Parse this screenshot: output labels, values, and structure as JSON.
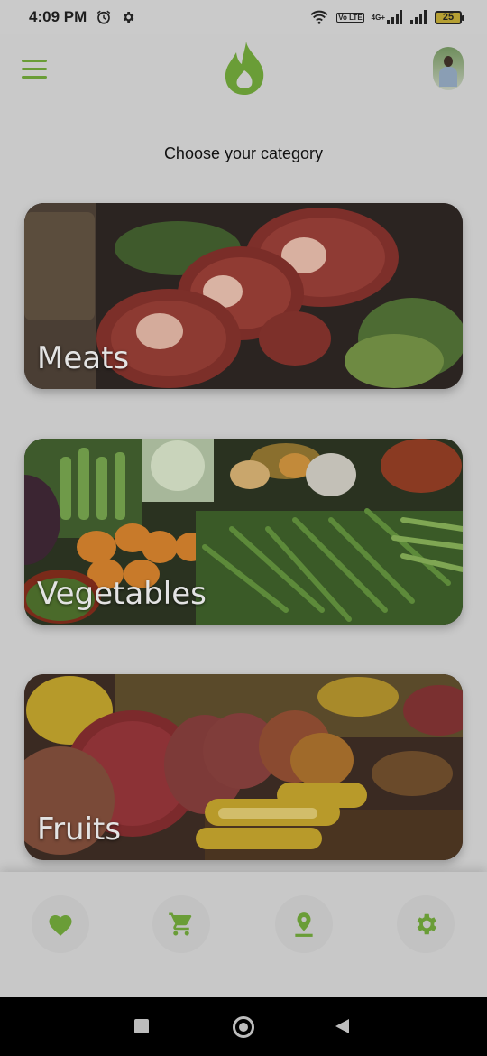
{
  "status_bar": {
    "time": "4:09 PM",
    "lte_label": "Vo LTE",
    "network_label": "4G+",
    "battery": "25"
  },
  "header": {
    "menu_icon": "hamburger-menu-icon",
    "logo_icon": "flame-logo-icon",
    "avatar_icon": "user-avatar"
  },
  "title": "Choose your category",
  "categories": [
    {
      "label": "Meats"
    },
    {
      "label": "Vegetables"
    },
    {
      "label": "Fruits"
    }
  ],
  "bottom_nav": {
    "items": [
      "heart-icon",
      "cart-icon",
      "location-icon",
      "gear-icon"
    ]
  },
  "colors": {
    "accent": "#6a9d37",
    "background": "#c9c9c9"
  }
}
